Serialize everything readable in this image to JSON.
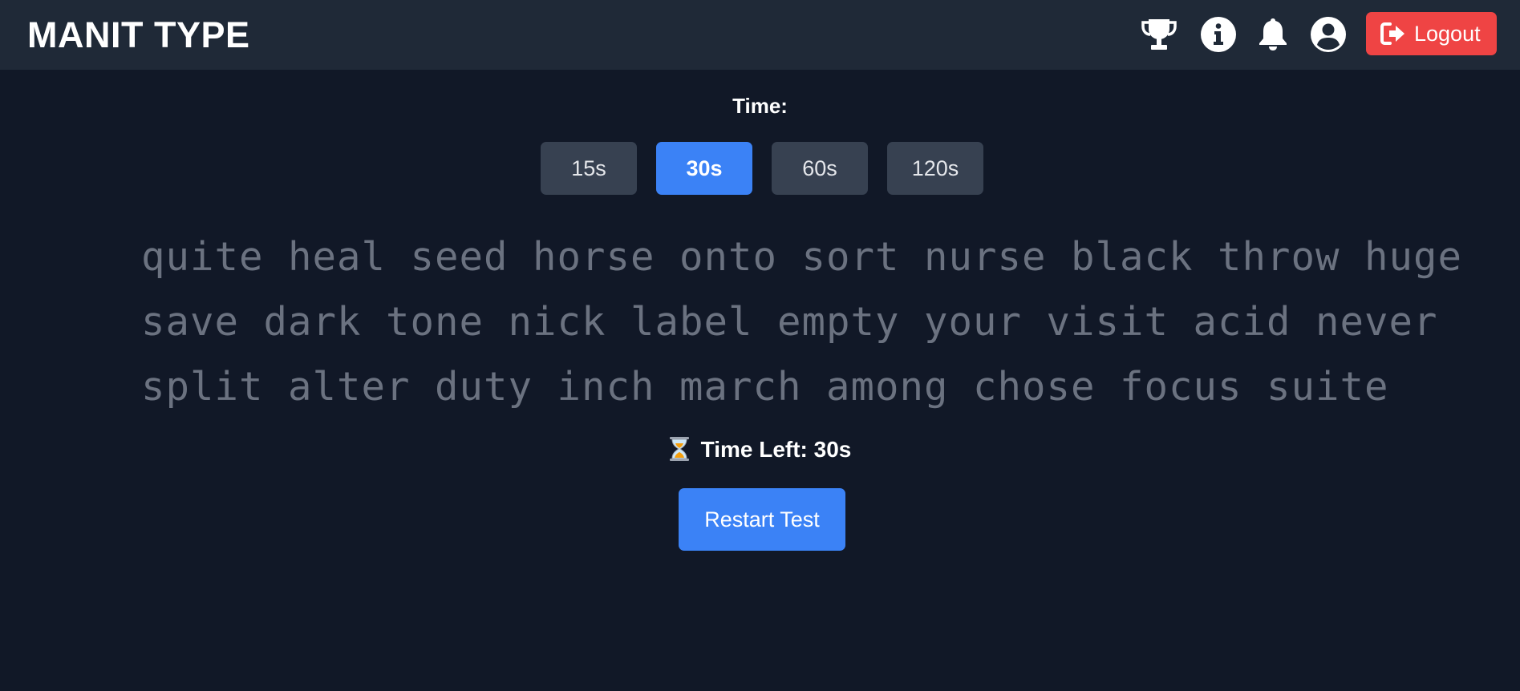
{
  "header": {
    "brand": "MANIT TYPE",
    "icons": [
      "trophy-icon",
      "info-icon",
      "bell-icon",
      "user-icon"
    ],
    "logout_label": "Logout",
    "logout_icon": "sign-out-icon"
  },
  "time_selector": {
    "label": "Time:",
    "options": [
      "15s",
      "30s",
      "60s",
      "120s"
    ],
    "selected": "30s"
  },
  "words": {
    "lines": [
      "quite heal seed horse onto sort nurse black throw huge",
      "save dark tone nick label empty your visit acid never",
      "split alter duty inch march among chose focus suite"
    ]
  },
  "timer": {
    "icon": "hourglass-icon",
    "text": "Time Left: 30s"
  },
  "restart_label": "Restart Test",
  "colors": {
    "background": "#111827",
    "header": "#1f2937",
    "accent": "#3b82f6",
    "danger": "#ef4444",
    "button_inactive": "#374151",
    "word_text": "#6b7280"
  }
}
